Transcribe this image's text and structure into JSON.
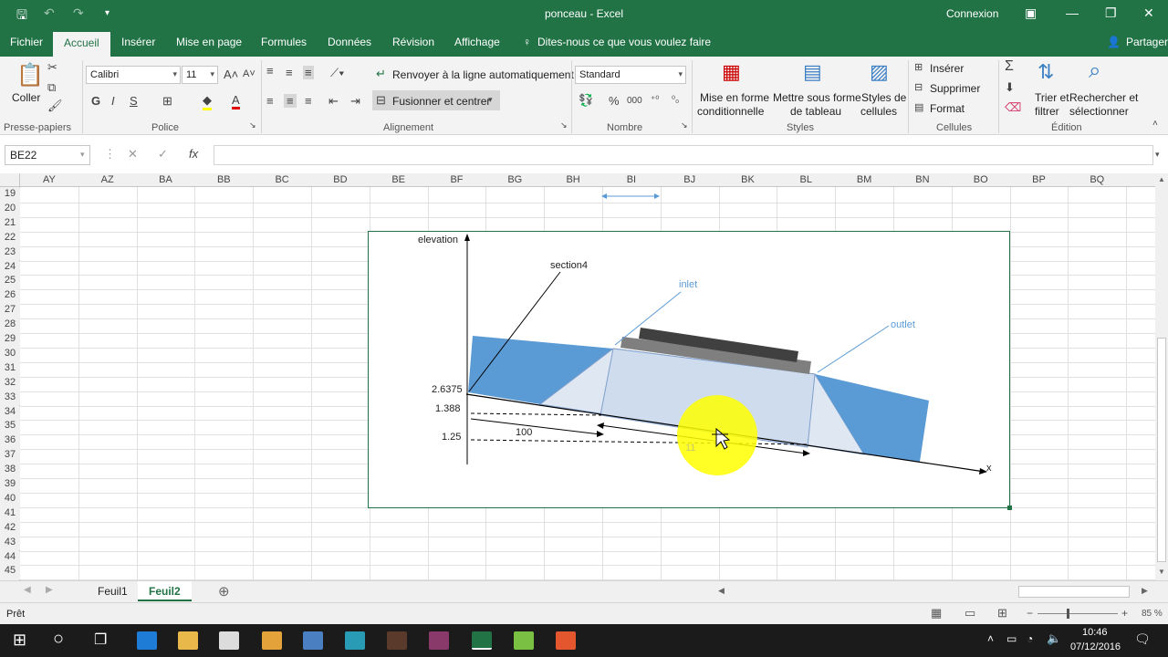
{
  "titlebar": {
    "title": "ponceau  -  Excel",
    "connexion": "Connexion"
  },
  "tabs": [
    "Fichier",
    "Accueil",
    "Insérer",
    "Mise en page",
    "Formules",
    "Données",
    "Révision",
    "Affichage"
  ],
  "tellme": "Dites-nous ce que vous voulez faire",
  "share": "Partager",
  "ribbon": {
    "paste": "Coller",
    "clipboard_group": "Presse-papiers",
    "font_name": "Calibri",
    "font_size": "11",
    "bold": "G",
    "italic": "I",
    "underline": "S",
    "police_group": "Police",
    "wrap": "Renvoyer à la ligne automatiquement",
    "merge": "Fusionner et centrer",
    "alignment_group": "Alignement",
    "number_format": "Standard",
    "percent": "%",
    "thousands": "000",
    "number_group": "Nombre",
    "cond_format_1": "Mise en forme",
    "cond_format_2": "conditionnelle",
    "table_1": "Mettre sous forme",
    "table_2": "de tableau",
    "styles_1": "Styles de",
    "styles_2": "cellules",
    "styles_group": "Styles",
    "insert": "Insérer",
    "delete": "Supprimer",
    "format": "Format",
    "cells_group": "Cellules",
    "sort_1": "Trier et",
    "sort_2": "filtrer",
    "find_1": "Rechercher et",
    "find_2": "sélectionner",
    "edit_group": "Édition"
  },
  "formula": {
    "namebox": "BE22",
    "fx": "fx"
  },
  "columns": [
    "AY",
    "AZ",
    "BA",
    "BB",
    "BC",
    "BD",
    "BE",
    "BF",
    "BG",
    "BH",
    "BI",
    "BJ",
    "BK",
    "BL",
    "BM",
    "BN",
    "BO",
    "BP",
    "BQ"
  ],
  "rows": [
    "19",
    "20",
    "21",
    "22",
    "23",
    "24",
    "25",
    "26",
    "27",
    "28",
    "29",
    "30",
    "31",
    "32",
    "33",
    "34",
    "35",
    "36",
    "37",
    "38",
    "39",
    "40",
    "41",
    "42",
    "43",
    "44",
    "45"
  ],
  "chart": {
    "y_axis_label": "elevation",
    "x_axis_label": "x",
    "section_label": "section4",
    "inlet_label": "inlet",
    "outlet_label": "outlet",
    "v1": "2.6375",
    "v2": "1.388",
    "v3": "1.25",
    "length": "100",
    "faded": "11"
  },
  "sheets": [
    "Feuil1",
    "Feuil2"
  ],
  "status": {
    "ready": "Prêt",
    "zoom": "85 %"
  },
  "taskbar": {
    "time": "10:46",
    "date": "07/12/2016"
  }
}
